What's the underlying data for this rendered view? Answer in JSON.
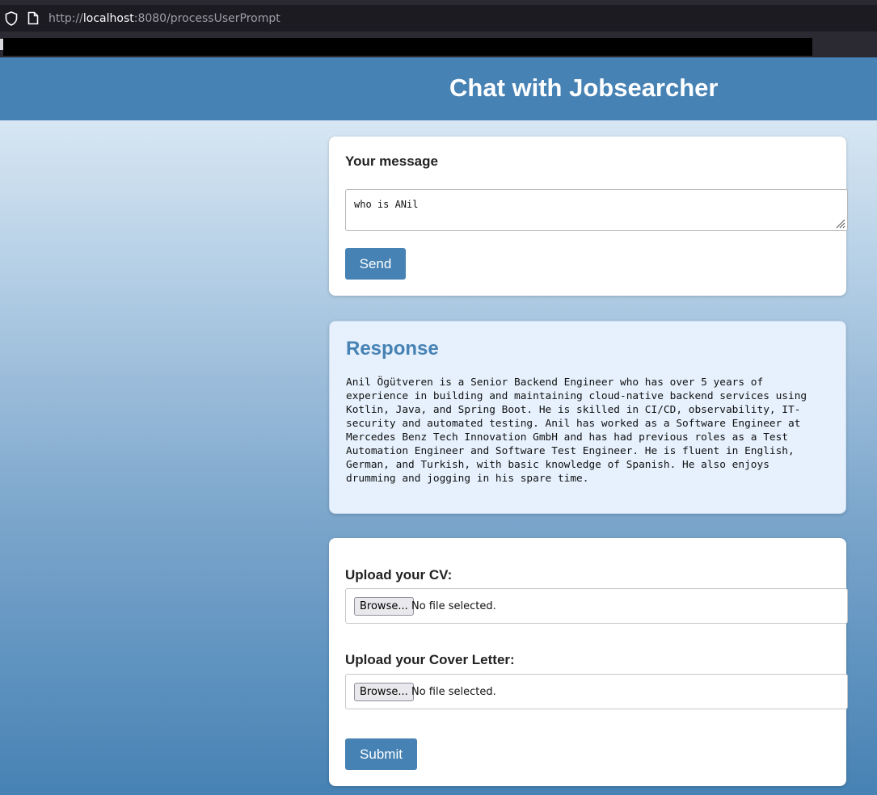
{
  "browser": {
    "url_prefix": "http://",
    "url_host": "localhost",
    "url_rest": ":8080/processUserPrompt"
  },
  "header": {
    "title": "Chat with Jobsearcher"
  },
  "message_form": {
    "label": "Your message",
    "input_value": "who is ANil",
    "send_label": "Send"
  },
  "response": {
    "heading": "Response",
    "lines": [
      "Anil Ögütveren is a Senior Backend Engineer who has over 5 years of",
      "experience in building and maintaining cloud-native backend services using",
      "Kotlin, Java, and Spring Boot. He is skilled in CI/CD, observability, IT-",
      "security and automated testing. Anil has worked as a Software Engineer at",
      "Mercedes Benz Tech Innovation GmbH and has had previous roles as a Test",
      "Automation Engineer and Software Test Engineer. He is fluent in English,",
      "German, and Turkish, with basic knowledge of Spanish. He also enjoys",
      "drumming and jogging in his spare time."
    ]
  },
  "upload_form": {
    "cv_label": "Upload your CV:",
    "cover_label": "Upload your Cover Letter:",
    "browse_label": "Browse...",
    "no_file_text": "No file selected.",
    "submit_label": "Submit"
  },
  "colors": {
    "accent": "#4682b4",
    "response_bg": "#e6f1fd"
  }
}
